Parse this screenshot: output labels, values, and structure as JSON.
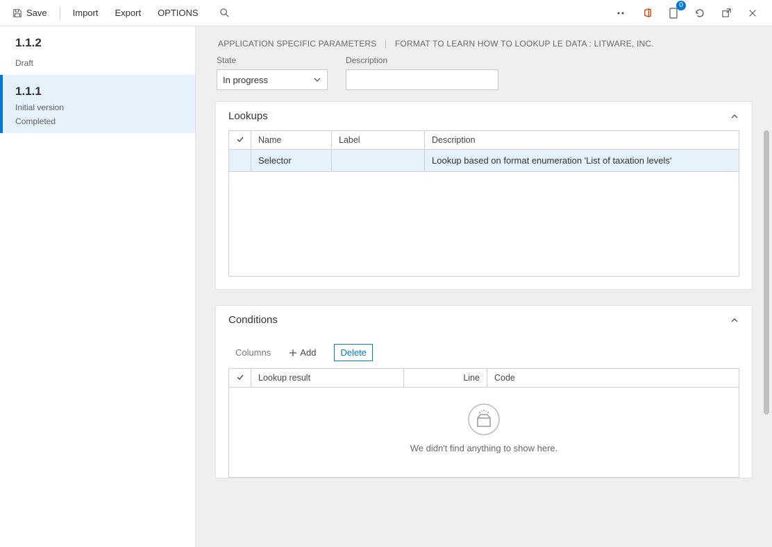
{
  "toolbar": {
    "save": "Save",
    "import": "Import",
    "export": "Export",
    "options": "OPTIONS",
    "notification_count": "0"
  },
  "sidebar": {
    "versions": [
      {
        "number": "1.1.2",
        "status": "Draft",
        "subtitle": "",
        "completed": ""
      },
      {
        "number": "1.1.1",
        "status": "",
        "subtitle": "Initial version",
        "completed": "Completed"
      }
    ]
  },
  "header": {
    "crumb1": "APPLICATION SPECIFIC PARAMETERS",
    "crumb2": "FORMAT TO LEARN HOW TO LOOKUP LE DATA : LITWARE, INC."
  },
  "form": {
    "state_label": "State",
    "state_value": "In progress",
    "desc_label": "Description",
    "desc_value": ""
  },
  "lookups": {
    "title": "Lookups",
    "columns": {
      "name": "Name",
      "label": "Label",
      "desc": "Description"
    },
    "rows": [
      {
        "name": "Selector",
        "label": "",
        "desc": "Lookup based on format enumeration 'List of taxation levels'"
      }
    ]
  },
  "conditions": {
    "title": "Conditions",
    "toolbar": {
      "columns": "Columns",
      "add": "Add",
      "delete": "Delete"
    },
    "columns": {
      "lookup": "Lookup result",
      "line": "Line",
      "code": "Code"
    },
    "empty_msg": "We didn't find anything to show here."
  }
}
